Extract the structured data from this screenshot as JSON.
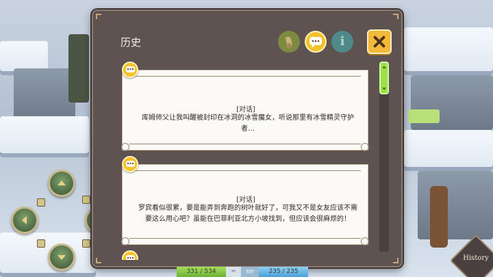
{
  "panel": {
    "title": "历史",
    "close_icon": "close-x-icon",
    "tabs": [
      {
        "icon": "filter-icon",
        "active": false
      },
      {
        "icon": "chat-bubble-icon",
        "active": true
      },
      {
        "icon": "info-icon",
        "glyph": "i",
        "active": false
      }
    ]
  },
  "history": [
    {
      "type": "[对话]",
      "text": "库姆师父让我叫醒被封印在冰洞的冰雪魔女，听说那里有冰雪精灵守护者…"
    },
    {
      "type": "[对话]",
      "text": "罗宾看似很累，要是能弄到奔跑的树叶就好了，可我又不是女友应该不需要这么用心吧？虽能在巴菲利亚北方小坡找到，但应该会很麻烦的！"
    }
  ],
  "hud": {
    "hp": "331 / 534",
    "mid": "≈",
    "mp_label": "MP",
    "mp": "235 / 235"
  },
  "history_button": "History",
  "colors": {
    "panel_bg": "#5f5352",
    "accent_yellow": "#f2b93a",
    "scroll_green": "#9ee04c"
  }
}
